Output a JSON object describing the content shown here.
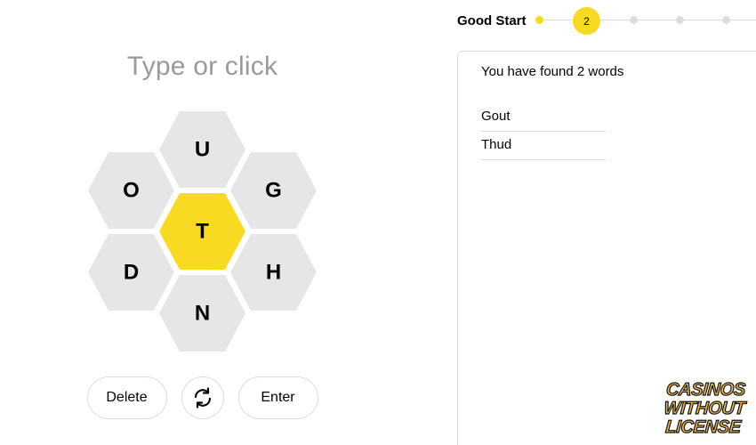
{
  "input": {
    "placeholder": "Type or click"
  },
  "hive": {
    "center_letter": "T",
    "outer_letters": [
      "U",
      "G",
      "H",
      "N",
      "D",
      "O"
    ],
    "colors": {
      "center": "#f7da21",
      "outer": "#e6e6e6"
    }
  },
  "controls": {
    "delete_label": "Delete",
    "shuffle_icon": "shuffle-icon",
    "enter_label": "Enter"
  },
  "progress": {
    "rank": "Good Start",
    "score": "2",
    "accent": "#f7da21"
  },
  "words": {
    "summary": "You have found 2 words",
    "list": [
      "Gout",
      "Thud"
    ]
  },
  "watermark": {
    "line1": "CASINOS",
    "line2": "WITHOUT",
    "line3": "LICENSE"
  }
}
